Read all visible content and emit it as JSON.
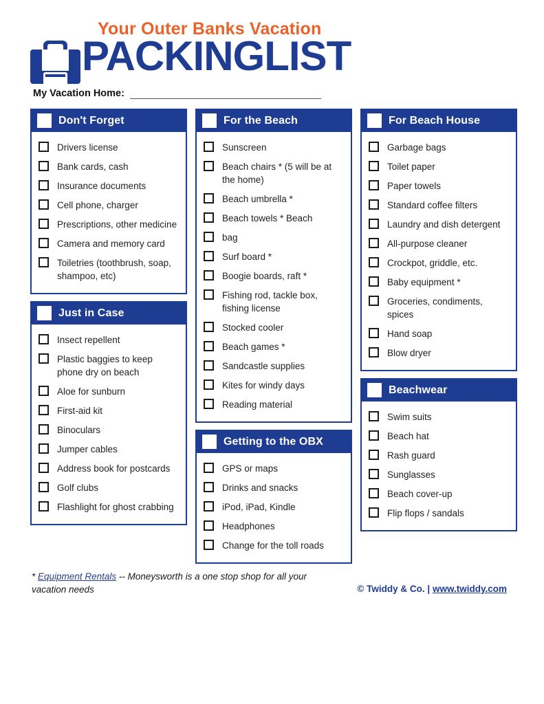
{
  "header": {
    "tagline": "Your Outer Banks Vacation",
    "wordmark": "PACKINGLIST",
    "logo_icon": "briefcase-icon",
    "tagline_color": "#E8622A",
    "brand_color": "#1F3C93"
  },
  "vacation_home": {
    "label": "My Vacation Home:",
    "value": ""
  },
  "columns": [
    {
      "sections": [
        {
          "title": "Don't Forget",
          "items": [
            "Drivers license",
            "Bank cards, cash",
            "Insurance documents",
            "Cell phone, charger",
            "Prescriptions, other medicine",
            "Camera and memory card",
            "Toiletries (toothbrush, soap, shampoo, etc)"
          ]
        },
        {
          "title": "Just in Case",
          "items": [
            "Insect repellent",
            "Plastic baggies to keep phone dry on beach",
            "Aloe for sunburn",
            "First-aid kit",
            "Binoculars",
            "Jumper cables",
            "Address book for postcards",
            "Golf clubs",
            "Flashlight for ghost crabbing"
          ]
        }
      ]
    },
    {
      "sections": [
        {
          "title": "For the Beach",
          "items": [
            "Sunscreen",
            "Beach chairs * (5 will be at the home)",
            "Beach umbrella *",
            "Beach towels * Beach",
            "bag",
            "Surf board *",
            "Boogie boards, raft *",
            "Fishing rod, tackle box, fishing license",
            "Stocked cooler",
            "Beach games *",
            "Sandcastle supplies",
            "Kites for windy days",
            "Reading material"
          ]
        },
        {
          "title": "Getting to the OBX",
          "items": [
            "GPS or maps",
            "Drinks and snacks",
            "iPod, iPad, Kindle",
            "Headphones",
            "Change for the toll roads"
          ]
        }
      ]
    },
    {
      "sections": [
        {
          "title": "For Beach House",
          "items": [
            "Garbage bags",
            "Toilet paper",
            "Paper towels",
            "Standard coffee filters",
            "Laundry and dish detergent",
            "All-purpose cleaner",
            "Crockpot, griddle, etc.",
            "Baby equipment *",
            "Groceries, condiments, spices",
            "Hand soap",
            "Blow dryer"
          ]
        },
        {
          "title": "Beachwear",
          "items": [
            "Swim suits",
            "Beach hat",
            "Rash guard",
            "Sunglasses",
            "Beach cover-up",
            "Flip flops / sandals"
          ]
        }
      ]
    }
  ],
  "footer": {
    "asterisk": "*",
    "link_text": "Equipment Rentals",
    "note_rest": "-- Moneysworth is a one stop shop for all your vacation needs",
    "credit_copyright": "© Twiddy & Co. |",
    "credit_url": "www.twiddy.com"
  }
}
